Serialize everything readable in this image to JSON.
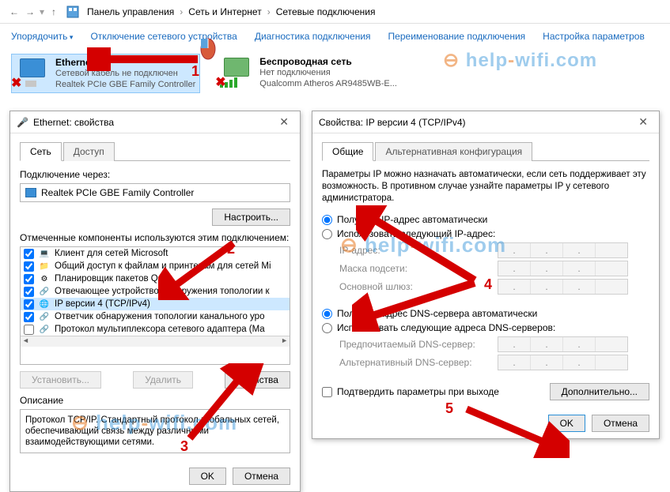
{
  "breadcrumb": {
    "parts": [
      "Панель управления",
      "Сеть и Интернет",
      "Сетевые подключения"
    ]
  },
  "toolbar": {
    "organize": "Упорядочить",
    "disable": "Отключение сетевого устройства",
    "diagnose": "Диагностика подключения",
    "rename": "Переименование подключения",
    "settings": "Настройка параметров"
  },
  "connections": {
    "ethernet": {
      "name": "Ethernet",
      "status": "Сетевой кабель не подключен",
      "adapter": "Realtek PCIe GBE Family Controller"
    },
    "wifi": {
      "name": "Беспроводная сеть",
      "status": "Нет подключения",
      "adapter": "Qualcomm Atheros AR9485WB-E..."
    }
  },
  "eth_props": {
    "title": "Ethernet: свойства",
    "tabs": {
      "network": "Сеть",
      "access": "Доступ"
    },
    "connect_via_label": "Подключение через:",
    "adapter": "Realtek PCIe GBE Family Controller",
    "configure_btn": "Настроить...",
    "components_label": "Отмеченные компоненты используются этим подключением:",
    "components": [
      "Клиент для сетей Microsoft",
      "Общий доступ к файлам и принтерам для сетей Mi",
      "Планировщик пакетов QoS",
      "Отвечающее устройство обнаружения топологии к",
      "IP версии 4 (TCP/IPv4)",
      "Ответчик обнаружения топологии канального уро",
      "Протокол мультиплексора сетевого адаптера (Ma"
    ],
    "install_btn": "Установить...",
    "remove_btn": "Удалить",
    "props_btn": "Свойства",
    "desc_label": "Описание",
    "desc_text": "Протокол TCP/IP. Стандартный протокол глобальных сетей, обеспечивающий связь между различными взаимодействующими сетями.",
    "ok": "OK",
    "cancel": "Отмена"
  },
  "ipv4": {
    "title": "Свойства: IP версии 4 (TCP/IPv4)",
    "tabs": {
      "general": "Общие",
      "alt": "Альтернативная конфигурация"
    },
    "intro": "Параметры IP можно назначать автоматически, если сеть поддерживает эту возможность. В противном случае узнайте параметры IP у сетевого администратора.",
    "ip_auto": "Получить IP-адрес автоматически",
    "ip_manual": "Использовать следующий IP-адрес:",
    "ip_addr": "IP-адрес:",
    "mask": "Маска подсети:",
    "gateway": "Основной шлюз:",
    "dns_auto": "Получить адрес DNS-сервера автоматически",
    "dns_manual": "Использовать следующие адреса DNS-серверов:",
    "dns_pref": "Предпочитаемый DNS-сервер:",
    "dns_alt": "Альтернативный DNS-сервер:",
    "confirm_exit": "Подтвердить параметры при выходе",
    "advanced": "Дополнительно...",
    "ok": "OK",
    "cancel": "Отмена"
  },
  "watermark": "help-wifi.com",
  "anno": {
    "n1": "1",
    "n2": "2",
    "n3": "3",
    "n4": "4",
    "n5": "5"
  }
}
